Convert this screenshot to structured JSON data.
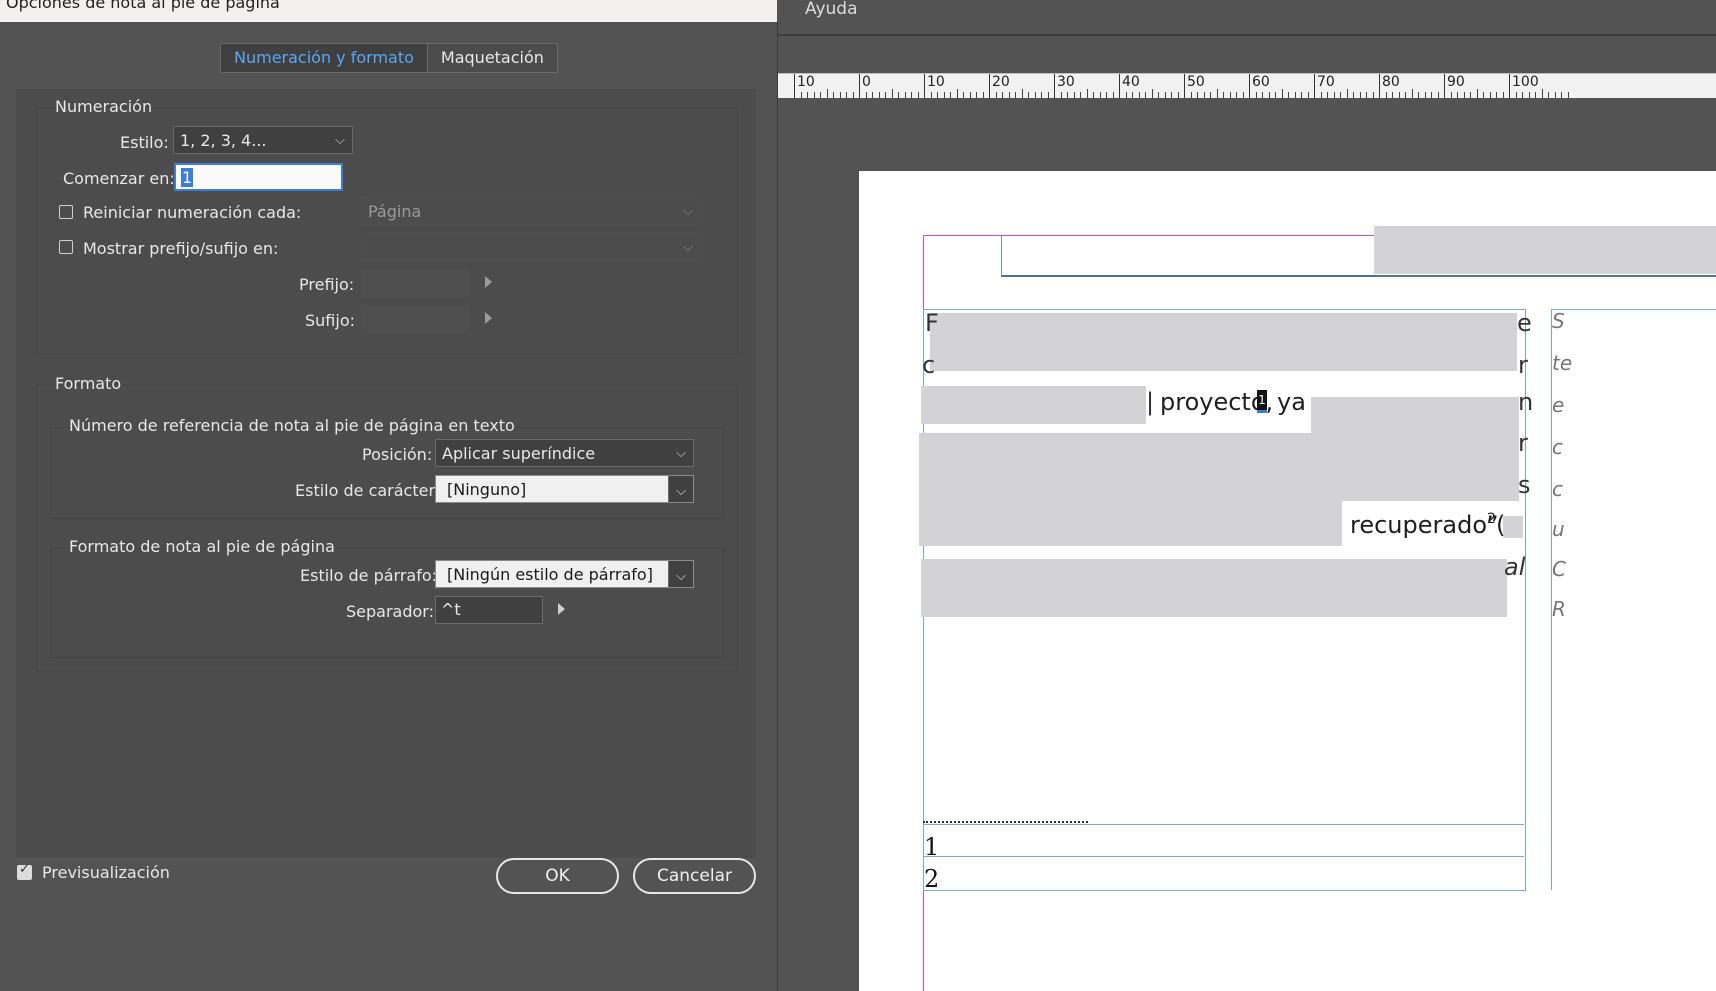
{
  "dialog": {
    "title": "Opciones de nota al pie de página",
    "tabs": [
      {
        "label": "Numeración y formato",
        "active": true
      },
      {
        "label": "Maquetación",
        "active": false
      }
    ],
    "numeracion": {
      "group_title": "Numeración",
      "estilo_label": "Estilo:",
      "estilo_value": "1, 2, 3, 4...",
      "comenzar_label": "Comenzar en:",
      "comenzar_value": "1",
      "reiniciar_label": "Reiniciar numeración cada:",
      "reiniciar_checked": false,
      "reiniciar_value": "Página",
      "mostrar_label": "Mostrar prefijo/sufijo en:",
      "mostrar_checked": false,
      "mostrar_value": "",
      "prefijo_label": "Prefijo:",
      "sufijo_label": "Sufijo:"
    },
    "formato": {
      "group_title": "Formato",
      "referencia_title": "Número de referencia de nota al pie de página en texto",
      "posicion_label": "Posición:",
      "posicion_value": "Aplicar superíndice",
      "estilo_caracter_label": "Estilo de carácter:",
      "estilo_caracter_value": "[Ninguno]",
      "nota_title": "Formato de nota al pie de página",
      "estilo_parrafo_label": "Estilo de párrafo:",
      "estilo_parrafo_value": "[Ningún estilo de párrafo]",
      "separador_label": "Separador:",
      "separador_value": "^t"
    },
    "preview_label": "Previsualización",
    "preview_checked": true,
    "ok_label": "OK",
    "cancel_label": "Cancelar"
  },
  "app": {
    "menu_help": "Ayuda",
    "ruler_labels": [
      "10",
      "0",
      "10",
      "20",
      "30",
      "40",
      "50",
      "60",
      "70",
      "80",
      "90",
      "100"
    ]
  },
  "document": {
    "word_proyecto": "proyecto,",
    "footnote_ref": "1",
    "word_ya": "ya",
    "word_recuperado": "recuperado”",
    "superscript_2": "2",
    "paren": "(",
    "footnote_numbers": [
      "1",
      "2"
    ]
  },
  "colors": {
    "accent": "#5aa7f5",
    "panel": "#4c4c4c",
    "background": "#535353",
    "frame_magenta": "#c94cc9",
    "frame_blue": "#7aa7d6"
  }
}
